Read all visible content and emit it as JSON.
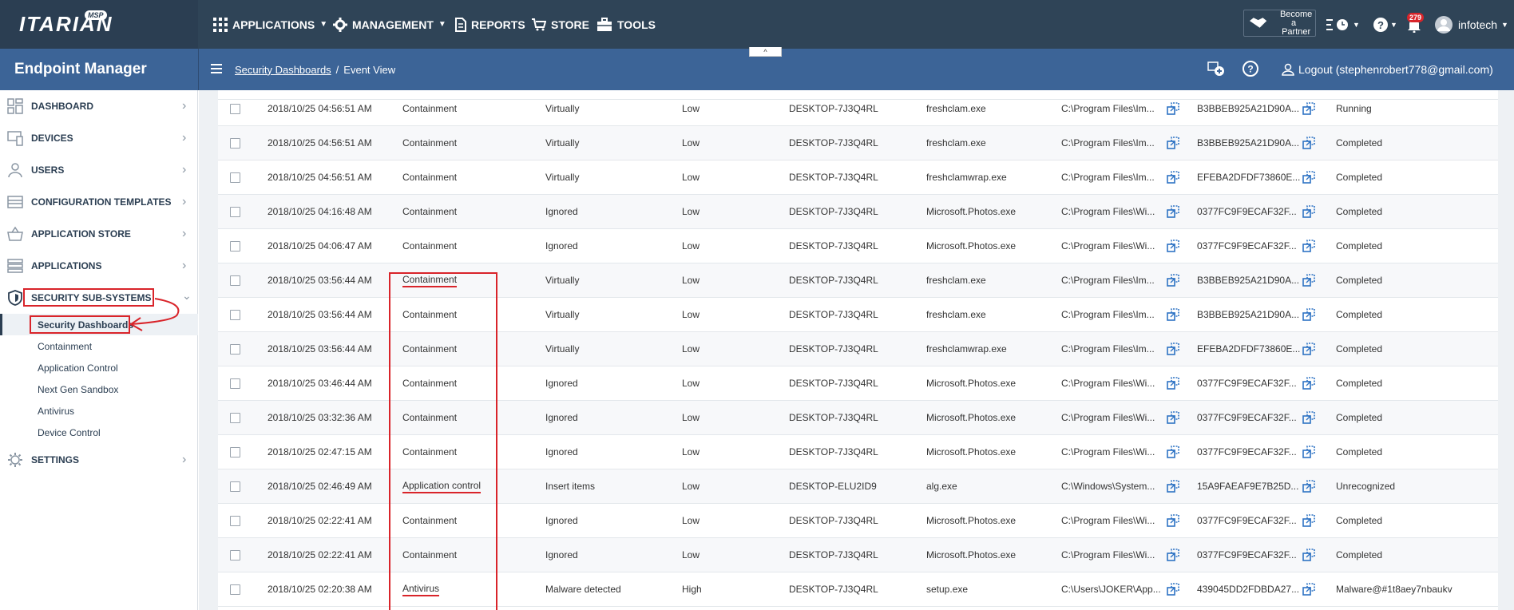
{
  "brand": {
    "logo": "ITARIAN",
    "msp": "MSP"
  },
  "topnav": {
    "applications": "APPLICATIONS",
    "management": "MANAGEMENT",
    "reports": "REPORTS",
    "store": "STORE",
    "tools": "TOOLS",
    "partner_line1": "Become a",
    "partner_line2": "Partner",
    "notifications_count": "279",
    "user": "infotech"
  },
  "subheader": {
    "app_title": "Endpoint Manager",
    "breadcrumb_link": "Security Dashboards",
    "breadcrumb_sep": "/",
    "breadcrumb_current": "Event View",
    "logout": "Logout (stephenrobert778@gmail.com)"
  },
  "sidebar": {
    "items": [
      {
        "label": "DASHBOARD",
        "icon": "dashboard-icon"
      },
      {
        "label": "DEVICES",
        "icon": "devices-icon"
      },
      {
        "label": "USERS",
        "icon": "user-icon"
      },
      {
        "label": "CONFIGURATION TEMPLATES",
        "icon": "templates-icon"
      },
      {
        "label": "APPLICATION STORE",
        "icon": "basket-icon"
      },
      {
        "label": "APPLICATIONS",
        "icon": "applications-icon"
      },
      {
        "label": "SECURITY SUB-SYSTEMS",
        "icon": "shield-icon"
      },
      {
        "label": "SETTINGS",
        "icon": "gear-icon"
      }
    ],
    "subitems": [
      {
        "label": "Security Dashboards"
      },
      {
        "label": "Containment"
      },
      {
        "label": "Application Control"
      },
      {
        "label": "Next Gen Sandbox"
      },
      {
        "label": "Antivirus"
      },
      {
        "label": "Device Control"
      }
    ]
  },
  "table": {
    "rows": [
      {
        "date": "2018/10/25 04:56:51 AM",
        "type": "Containment",
        "action": "Virtually",
        "severity": "Low",
        "device": "DESKTOP-7J3Q4RL",
        "file": "freshclam.exe",
        "path": "C:\\Program Files\\Im...",
        "hash": "B3BBEB925A21D90A...",
        "status": "Running"
      },
      {
        "date": "2018/10/25 04:56:51 AM",
        "type": "Containment",
        "action": "Virtually",
        "severity": "Low",
        "device": "DESKTOP-7J3Q4RL",
        "file": "freshclam.exe",
        "path": "C:\\Program Files\\Im...",
        "hash": "B3BBEB925A21D90A...",
        "status": "Completed"
      },
      {
        "date": "2018/10/25 04:56:51 AM",
        "type": "Containment",
        "action": "Virtually",
        "severity": "Low",
        "device": "DESKTOP-7J3Q4RL",
        "file": "freshclamwrap.exe",
        "path": "C:\\Program Files\\Im...",
        "hash": "EFEBA2DFDF73860E...",
        "status": "Completed"
      },
      {
        "date": "2018/10/25 04:16:48 AM",
        "type": "Containment",
        "action": "Ignored",
        "severity": "Low",
        "device": "DESKTOP-7J3Q4RL",
        "file": "Microsoft.Photos.exe",
        "path": "C:\\Program Files\\Wi...",
        "hash": "0377FC9F9ECAF32F...",
        "status": "Completed"
      },
      {
        "date": "2018/10/25 04:06:47 AM",
        "type": "Containment",
        "action": "Ignored",
        "severity": "Low",
        "device": "DESKTOP-7J3Q4RL",
        "file": "Microsoft.Photos.exe",
        "path": "C:\\Program Files\\Wi...",
        "hash": "0377FC9F9ECAF32F...",
        "status": "Completed"
      },
      {
        "date": "2018/10/25 03:56:44 AM",
        "type": "Containment",
        "action": "Virtually",
        "severity": "Low",
        "device": "DESKTOP-7J3Q4RL",
        "file": "freshclam.exe",
        "path": "C:\\Program Files\\Im...",
        "hash": "B3BBEB925A21D90A...",
        "status": "Completed"
      },
      {
        "date": "2018/10/25 03:56:44 AM",
        "type": "Containment",
        "action": "Virtually",
        "severity": "Low",
        "device": "DESKTOP-7J3Q4RL",
        "file": "freshclam.exe",
        "path": "C:\\Program Files\\Im...",
        "hash": "B3BBEB925A21D90A...",
        "status": "Completed"
      },
      {
        "date": "2018/10/25 03:56:44 AM",
        "type": "Containment",
        "action": "Virtually",
        "severity": "Low",
        "device": "DESKTOP-7J3Q4RL",
        "file": "freshclamwrap.exe",
        "path": "C:\\Program Files\\Im...",
        "hash": "EFEBA2DFDF73860E...",
        "status": "Completed"
      },
      {
        "date": "2018/10/25 03:46:44 AM",
        "type": "Containment",
        "action": "Ignored",
        "severity": "Low",
        "device": "DESKTOP-7J3Q4RL",
        "file": "Microsoft.Photos.exe",
        "path": "C:\\Program Files\\Wi...",
        "hash": "0377FC9F9ECAF32F...",
        "status": "Completed"
      },
      {
        "date": "2018/10/25 03:32:36 AM",
        "type": "Containment",
        "action": "Ignored",
        "severity": "Low",
        "device": "DESKTOP-7J3Q4RL",
        "file": "Microsoft.Photos.exe",
        "path": "C:\\Program Files\\Wi...",
        "hash": "0377FC9F9ECAF32F...",
        "status": "Completed"
      },
      {
        "date": "2018/10/25 02:47:15 AM",
        "type": "Containment",
        "action": "Ignored",
        "severity": "Low",
        "device": "DESKTOP-7J3Q4RL",
        "file": "Microsoft.Photos.exe",
        "path": "C:\\Program Files\\Wi...",
        "hash": "0377FC9F9ECAF32F...",
        "status": "Completed"
      },
      {
        "date": "2018/10/25 02:46:49 AM",
        "type": "Application control",
        "action": "Insert items",
        "severity": "Low",
        "device": "DESKTOP-ELU2ID9",
        "file": "alg.exe",
        "path": "C:\\Windows\\System...",
        "hash": "15A9FAEAF9E7B25D...",
        "status": "Unrecognized"
      },
      {
        "date": "2018/10/25 02:22:41 AM",
        "type": "Containment",
        "action": "Ignored",
        "severity": "Low",
        "device": "DESKTOP-7J3Q4RL",
        "file": "Microsoft.Photos.exe",
        "path": "C:\\Program Files\\Wi...",
        "hash": "0377FC9F9ECAF32F...",
        "status": "Completed"
      },
      {
        "date": "2018/10/25 02:22:41 AM",
        "type": "Containment",
        "action": "Ignored",
        "severity": "Low",
        "device": "DESKTOP-7J3Q4RL",
        "file": "Microsoft.Photos.exe",
        "path": "C:\\Program Files\\Wi...",
        "hash": "0377FC9F9ECAF32F...",
        "status": "Completed"
      },
      {
        "date": "2018/10/25 02:20:38 AM",
        "type": "Antivirus",
        "action": "Malware detected",
        "severity": "High",
        "device": "DESKTOP-7J3Q4RL",
        "file": "setup.exe",
        "path": "C:\\Users\\JOKER\\App...",
        "hash": "439045DD2FDBDA27...",
        "status": "Malware@#1t8aey7nbaukv"
      }
    ]
  },
  "colors": {
    "topbar": "#2b3e52",
    "subheader": "#3c6497",
    "annotation": "#d9242a",
    "copy_icon": "#2e73c4"
  }
}
